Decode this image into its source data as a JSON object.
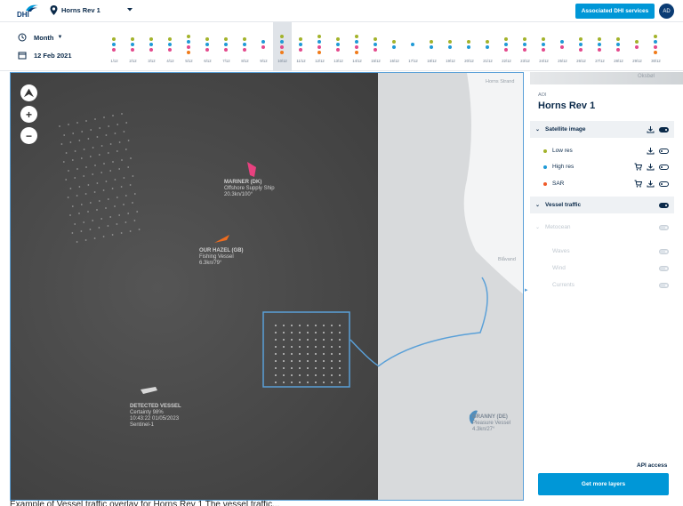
{
  "header": {
    "logo_text": "DHI",
    "site_name": "Horns Rev 1",
    "associated_button": "Associated DHI services",
    "avatar_initials": "AD",
    "brand_color": "#0097d7"
  },
  "timeline": {
    "period": "Month",
    "date": "12 Feb 2021",
    "selected_index": 9,
    "days": [
      {
        "label": "1/12",
        "dots": [
          "#a3b32b",
          "#1f9ad6",
          "#e34a8c"
        ]
      },
      {
        "label": "2/12",
        "dots": [
          "#a3b32b",
          "#1f9ad6",
          "#e34a8c"
        ]
      },
      {
        "label": "3/12",
        "dots": [
          "#a3b32b",
          "#1f9ad6",
          "#e34a8c"
        ]
      },
      {
        "label": "4/12",
        "dots": [
          "#a3b32b",
          "#1f9ad6",
          "#e34a8c"
        ]
      },
      {
        "label": "5/12",
        "dots": [
          "#a3b32b",
          "#1f9ad6",
          "#e34a8c",
          "#f07b1a"
        ]
      },
      {
        "label": "6/12",
        "dots": [
          "#a3b32b",
          "#1f9ad6",
          "#e34a8c"
        ]
      },
      {
        "label": "7/12",
        "dots": [
          "#a3b32b",
          "#1f9ad6",
          "#e34a8c"
        ]
      },
      {
        "label": "8/12",
        "dots": [
          "#a3b32b",
          "#1f9ad6",
          "#e34a8c"
        ]
      },
      {
        "label": "9/12",
        "dots": [
          "#1f9ad6",
          "#e34a8c"
        ]
      },
      {
        "label": "10/12",
        "dots": [
          "#a3b32b",
          "#1f9ad6",
          "#e34a8c",
          "#f07b1a"
        ]
      },
      {
        "label": "11/12",
        "dots": [
          "#a3b32b",
          "#1f9ad6",
          "#e34a8c"
        ]
      },
      {
        "label": "12/12",
        "dots": [
          "#a3b32b",
          "#1f9ad6",
          "#e34a8c",
          "#f07b1a"
        ]
      },
      {
        "label": "13/12",
        "dots": [
          "#a3b32b",
          "#1f9ad6",
          "#e34a8c"
        ]
      },
      {
        "label": "14/12",
        "dots": [
          "#a3b32b",
          "#1f9ad6",
          "#e34a8c",
          "#f07b1a"
        ]
      },
      {
        "label": "15/12",
        "dots": [
          "#a3b32b",
          "#1f9ad6",
          "#e34a8c"
        ]
      },
      {
        "label": "16/12",
        "dots": [
          "#a3b32b",
          "#1f9ad6"
        ]
      },
      {
        "label": "17/12",
        "dots": [
          "#1f9ad6"
        ]
      },
      {
        "label": "18/12",
        "dots": [
          "#a3b32b",
          "#1f9ad6"
        ]
      },
      {
        "label": "19/12",
        "dots": [
          "#a3b32b",
          "#1f9ad6"
        ]
      },
      {
        "label": "20/12",
        "dots": [
          "#a3b32b",
          "#1f9ad6"
        ]
      },
      {
        "label": "21/12",
        "dots": [
          "#a3b32b",
          "#1f9ad6"
        ]
      },
      {
        "label": "22/12",
        "dots": [
          "#a3b32b",
          "#1f9ad6",
          "#e34a8c"
        ]
      },
      {
        "label": "23/12",
        "dots": [
          "#a3b32b",
          "#1f9ad6",
          "#e34a8c"
        ]
      },
      {
        "label": "24/12",
        "dots": [
          "#a3b32b",
          "#1f9ad6",
          "#e34a8c"
        ]
      },
      {
        "label": "25/12",
        "dots": [
          "#1f9ad6",
          "#e34a8c"
        ]
      },
      {
        "label": "26/12",
        "dots": [
          "#a3b32b",
          "#1f9ad6",
          "#e34a8c"
        ]
      },
      {
        "label": "27/12",
        "dots": [
          "#a3b32b",
          "#1f9ad6",
          "#e34a8c"
        ]
      },
      {
        "label": "28/12",
        "dots": [
          "#a3b32b",
          "#1f9ad6",
          "#e34a8c"
        ]
      },
      {
        "label": "29/12",
        "dots": [
          "#a3b32b",
          "#e34a8c"
        ]
      },
      {
        "label": "30/12",
        "dots": [
          "#a3b32b",
          "#1f9ad6",
          "#e34a8c",
          "#f07b1a"
        ]
      }
    ]
  },
  "map": {
    "controls": {
      "north": "⮝",
      "zoom_in": "+",
      "zoom_out": "−"
    },
    "place_labels": [
      "Horns Strand",
      "Oksbøl",
      "Blåvand"
    ],
    "vessels": [
      {
        "name": "MARINER (DK)",
        "type": "Offshore Supply Ship",
        "speed": "20.3kn/100°",
        "color": "#e8417f"
      },
      {
        "name": "OUR HAZEL (GB)",
        "type": "Fishing Vessel",
        "speed": "6.3kn/79°",
        "color": "#ee6c1f"
      },
      {
        "name": "DETECTED VESSEL",
        "line2": "Certainty 98%",
        "line3": "10:43:22 01/05/2023",
        "line4": "Sentinel-1",
        "color": "#d8d8d8"
      },
      {
        "name": "GRANNY (DE)",
        "type": "Pleasure Vessel",
        "speed": "4.3kn/27°",
        "color": "#4f8fbf"
      }
    ]
  },
  "panel": {
    "kicker": "AOI",
    "title": "Horns Rev 1",
    "satellite_section": "Satellite image",
    "layers": [
      {
        "label": "Low res",
        "color": "#a3b32b",
        "cart": false
      },
      {
        "label": "High res",
        "color": "#1f9ad6",
        "cart": true
      },
      {
        "label": "SAR",
        "color": "#f05a28",
        "cart": true
      }
    ],
    "vessel_section": "Vessel traffic",
    "metocean_section": "Metocean",
    "metocean_layers": [
      "Waves",
      "Wind",
      "Currents"
    ],
    "api_access": "API access",
    "more_layers_button": "Get more layers"
  },
  "caption": "Example of Vessel traffic overlay for Horns Rev 1 The vessel traffic..."
}
